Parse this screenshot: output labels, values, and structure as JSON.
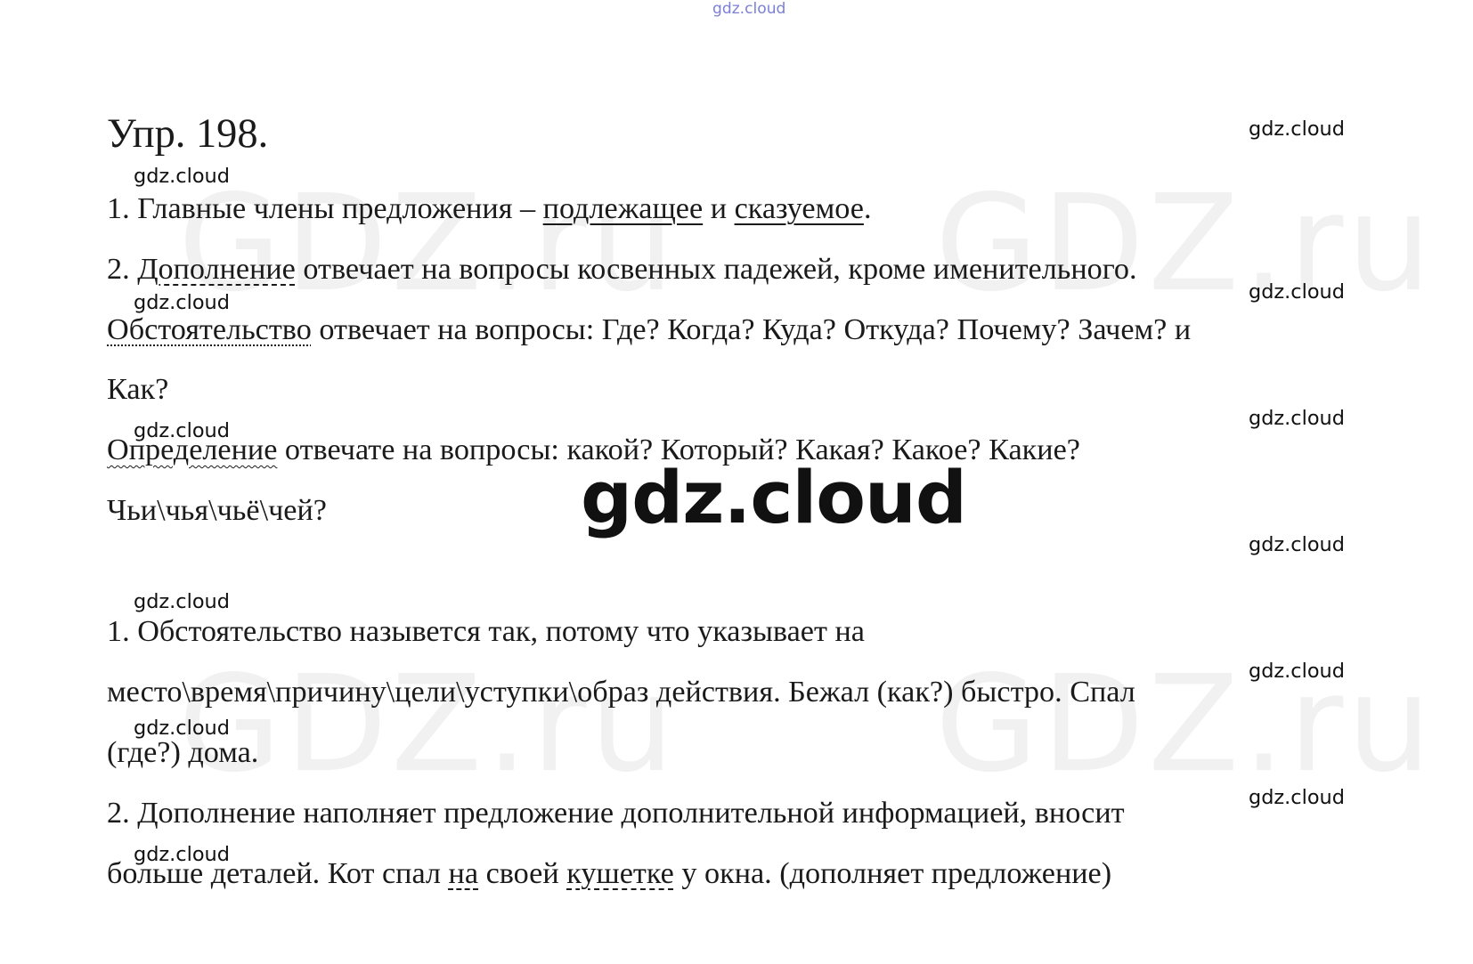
{
  "watermarks": {
    "top": "gdz.cloud",
    "big": "gdz.cloud",
    "small": "gdz.cloud",
    "ghost": "GDZ.ru"
  },
  "title": "Упр. 198.",
  "part1": {
    "l1": {
      "a": "1. Главные члены предложения – ",
      "b": "подлежащее",
      "c": " и ",
      "d": "сказуемое",
      "e": "."
    },
    "l2": {
      "a": "2. ",
      "b": "Дополнение",
      "c": " отвечает на вопросы косвенных падежей, кроме именительного."
    },
    "l3": {
      "a": "Обстоятельство",
      "b": " отвечает на вопросы: Где? Когда? Куда? Откуда? Почему? Зачем? и"
    },
    "l4": "Как?",
    "l5": {
      "a": "Определение",
      "b": " отвечате на вопросы: какой? Который? Какая? Какое? Какие?"
    },
    "l6": "Чьи\\чья\\чьё\\чей?"
  },
  "part2": {
    "l1": "1. Обстоятельство назывется так, потому что указывает на",
    "l2": "место\\время\\причину\\цели\\уступки\\образ действия. Бежал (как?) быстро. Спал",
    "l3": "(где?) дома.",
    "l4": "2. Дополнение наполняет предложение дополнительной информацией, вносит",
    "l5": {
      "a": "больше деталей. Кот спал ",
      "b": "на",
      "c": " своей ",
      "d": "кушетке",
      "e": " у окна. (дополняет предложение)"
    }
  }
}
